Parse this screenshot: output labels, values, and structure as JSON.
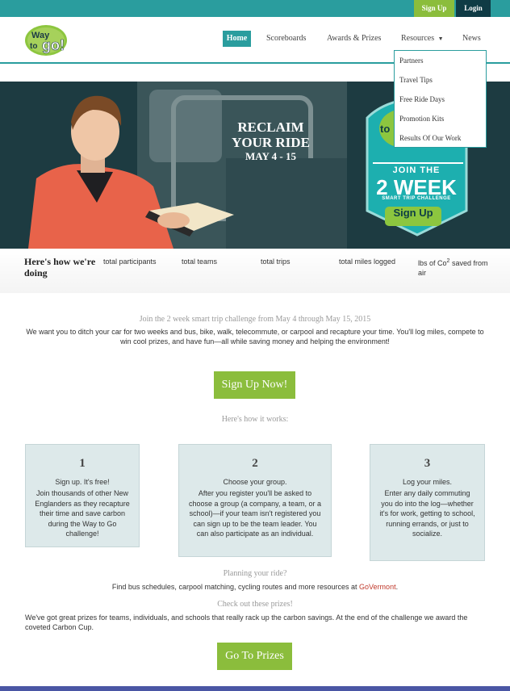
{
  "topbar": {
    "signup_label": "Sign Up",
    "login_label": "Login"
  },
  "brand": {
    "logo_text_way": "Way",
    "logo_text_to": "to",
    "logo_text_go": "go!"
  },
  "nav": {
    "home": "Home",
    "scoreboards": "Scoreboards",
    "awards": "Awards & Prizes",
    "resources": "Resources",
    "news": "News"
  },
  "dropdown": [
    "Partners",
    "Travel Tips",
    "Free Ride Days",
    "Promotion Kits",
    "Results Of Our Work"
  ],
  "hero": {
    "title_line1": "RECLAIM",
    "title_line2": "YOUR RIDE",
    "dates": "MAY 4 - 15",
    "badge_join": "JOIN THE",
    "badge_weeks": "2 WEEK",
    "badge_smart": "SMART TRIP CHALLENGE",
    "badge_button": "Sign Up",
    "badge_partial": "to"
  },
  "stats": {
    "title": "Here's how we're doing",
    "labels": [
      "total participants",
      "total teams",
      "total trips",
      "total miles logged",
      "lbs of Co",
      "2",
      " saved from air"
    ]
  },
  "intro": {
    "subhead": "Join the 2 week smart trip challenge from May 4 through May 15, 2015",
    "body": "We want you to ditch your car for two weeks and bus, bike, walk, telecommute, or carpool and recapture your time. You'll log miles, compete to win cool prizes, and have fun—all while saving money and helping the environment!",
    "cta": "Sign Up Now!"
  },
  "how": {
    "subhead": "Here's how it works:",
    "steps": [
      {
        "num": "1",
        "head": "Sign up. It's free!",
        "body": "Join thousands of other New Englanders as they recapture their time and save carbon during the Way to Go challenge!"
      },
      {
        "num": "2",
        "head": "Choose your group.",
        "body": "After you register you'll be asked to choose a group (a company, a team, or a school)—if your team isn't registered you can sign up to be the team leader. You can also participate as an individual."
      },
      {
        "num": "3",
        "head": "Log your miles.",
        "body": "Enter any daily commuting you do into the log—whether it's for work, getting to school, running errands, or just to socialize."
      }
    ]
  },
  "planning": {
    "subhead": "Planning your ride?",
    "body_prefix": "Find bus schedules, carpool matching, cycling routes and more resources at ",
    "link": "GoVermont",
    "body_suffix": "."
  },
  "prizes": {
    "subhead": "Check out these prizes!",
    "body": "We've got great prizes for teams, individuals, and schools that really rack up the carbon savings. At the end of the challenge we award the coveted Carbon Cup.",
    "cta": "Go To Prizes"
  },
  "colors": {
    "teal": "#2a9d9e",
    "green": "#8bbd3c",
    "navy": "#0f3b45"
  },
  "icons": {
    "caret": "caret-down-icon"
  }
}
